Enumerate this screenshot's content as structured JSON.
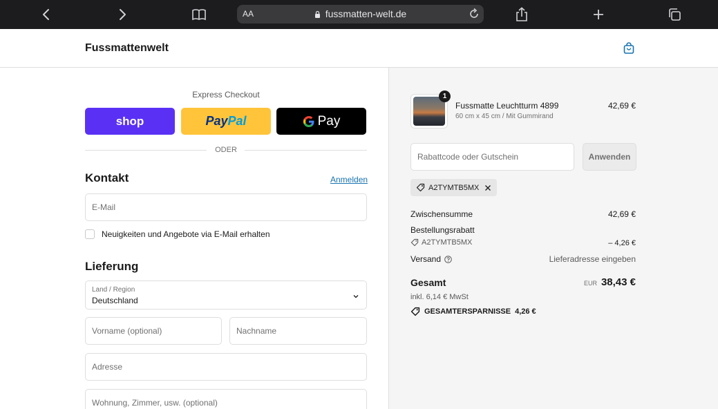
{
  "browser": {
    "url": "fussmatten-welt.de",
    "text_size_label": "AA"
  },
  "header": {
    "shop_name": "Fussmattenwelt"
  },
  "checkout": {
    "express_label": "Express Checkout",
    "shop_pay_label": "shop",
    "paypal_label_part1": "Pay",
    "paypal_label_part2": "Pal",
    "gpay_label": "Pay",
    "divider_label": "ODER",
    "contact": {
      "title": "Kontakt",
      "login_link": "Anmelden",
      "email_placeholder": "E-Mail",
      "newsletter_label": "Neuigkeiten und Angebote via E-Mail erhalten"
    },
    "delivery": {
      "title": "Lieferung",
      "country_label": "Land / Region",
      "country_value": "Deutschland",
      "first_name_placeholder": "Vorname (optional)",
      "last_name_placeholder": "Nachname",
      "address_placeholder": "Adresse",
      "apartment_placeholder": "Wohnung, Zimmer, usw. (optional)"
    }
  },
  "summary": {
    "product": {
      "quantity": "1",
      "name": "Fussmatte Leuchtturm 4899",
      "variant": "60 cm x 45 cm / Mit Gummirand",
      "price": "42,69 €"
    },
    "discount_placeholder": "Rabattcode oder Gutschein",
    "apply_label": "Anwenden",
    "applied_code": "A2TYMTB5MX",
    "subtotal_label": "Zwischensumme",
    "subtotal_value": "42,69 €",
    "order_discount_label": "Bestellungsrabatt",
    "order_discount_code": "A2TYMTB5MX",
    "order_discount_value": "– 4,26 €",
    "shipping_label": "Versand",
    "shipping_value": "Lieferadresse eingeben",
    "total_label": "Gesamt",
    "total_currency": "EUR",
    "total_value": "38,43 €",
    "tax_line": "inkl. 6,14 € MwSt",
    "savings_label": "GESAMTERSPARNISSE",
    "savings_value": "4,26 €"
  },
  "colors": {
    "shop_pay": "#5a31f4",
    "paypal": "#ffc439",
    "link": "#1773b0"
  }
}
